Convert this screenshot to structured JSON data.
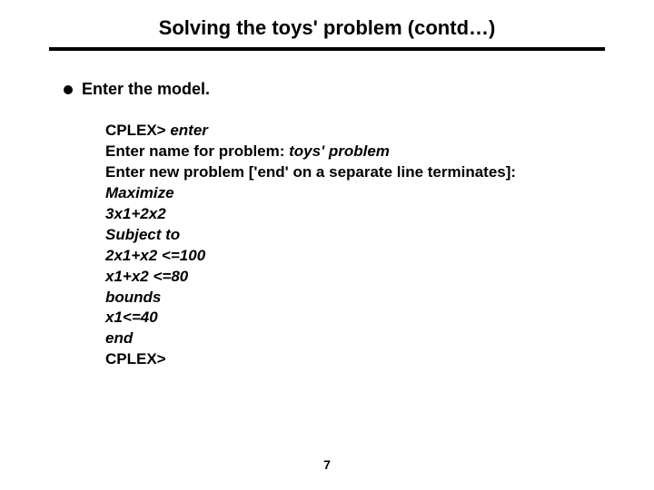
{
  "title": "Solving the toys' problem (contd…)",
  "bullet": {
    "text": "Enter the model."
  },
  "code": {
    "lines": [
      {
        "prefix": "CPLEX> ",
        "italic": "enter"
      },
      {
        "prefix": "Enter name for problem: ",
        "italic": "toys' problem"
      },
      {
        "prefix": "Enter new problem ['end' on a separate line terminates]:",
        "italic": ""
      },
      {
        "prefix": "",
        "italic": "Maximize"
      },
      {
        "prefix": "",
        "italic": "3x1+2x2"
      },
      {
        "prefix": "",
        "italic": "Subject to"
      },
      {
        "prefix": "",
        "italic": "2x1+x2 <=100"
      },
      {
        "prefix": "",
        "italic": "x1+x2 <=80"
      },
      {
        "prefix": "",
        "italic": "bounds"
      },
      {
        "prefix": "",
        "italic": "x1<=40"
      },
      {
        "prefix": "",
        "italic": "end"
      },
      {
        "prefix": "CPLEX>",
        "italic": ""
      }
    ]
  },
  "pageNumber": "7"
}
